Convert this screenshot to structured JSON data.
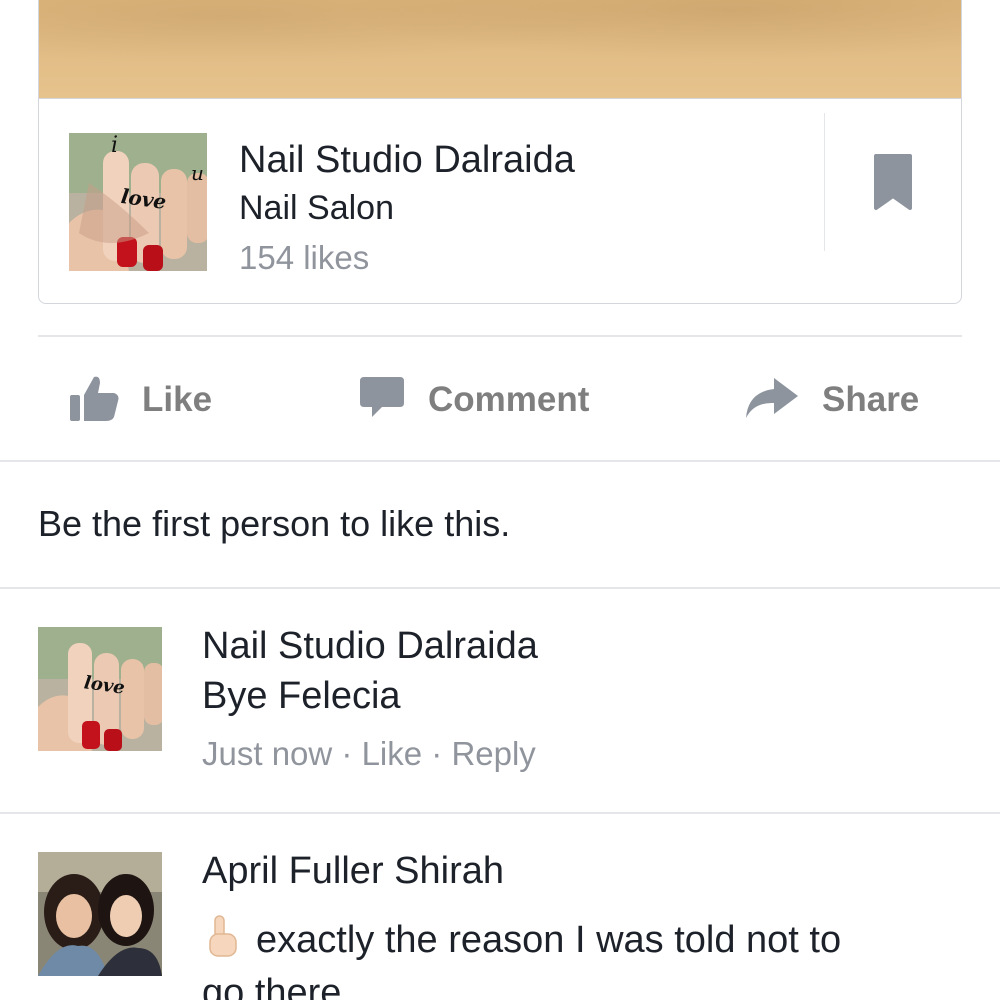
{
  "shared_card": {
    "title": "Nail Studio Dalraida",
    "category": "Nail Salon",
    "likes": "154 likes",
    "thumb_text": "love",
    "thumb_letter_top": "i",
    "thumb_letter_side": "u"
  },
  "actions": {
    "like": "Like",
    "comment": "Comment",
    "share": "Share"
  },
  "likes_summary": "Be the first person to like this.",
  "comments": [
    {
      "author": "Nail Studio Dalraida",
      "text": "Bye Felecia",
      "time": "Just now",
      "separator": " · ",
      "like": "Like",
      "reply": "Reply",
      "avatar_text": "love"
    },
    {
      "author": "April Fuller Shirah",
      "text": "exactly the reason I was told not to",
      "text_line2": "go there",
      "emoji": "pointing-up-hand"
    }
  ],
  "colors": {
    "text": "#1d2129",
    "muted": "#90949c",
    "action_gray": "#7f7f7f",
    "divider": "#e5e6e9",
    "icon_gray": "#8d949e"
  }
}
